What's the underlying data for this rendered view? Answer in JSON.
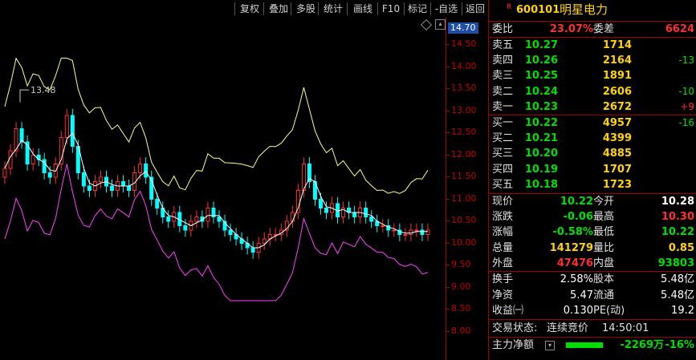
{
  "toolbar": {
    "items": [
      "复权",
      "叠加",
      "多股",
      "统计",
      "画线",
      "F10",
      "标记",
      "-自选",
      "返回"
    ]
  },
  "chart": {
    "price_label": "14.70",
    "y_ticks": [
      "14.50",
      "14.00",
      "13.50",
      "13.00",
      "12.50",
      "12.00",
      "11.50",
      "11.00",
      "10.50",
      "10.00",
      "9.50",
      "9.00",
      "8.50",
      "8.00"
    ],
    "high_marker": "13.48",
    "colors": {
      "up": "#ff3030",
      "down": "#00ffff",
      "upper_band": "#ffff80",
      "lower_band": "#ff40ff",
      "mid": "#ffffff",
      "axis": "#a00000"
    }
  },
  "quote": {
    "badge": "R",
    "code": "600101",
    "name": "明星电力",
    "wei_bi_label": "委比",
    "wei_bi": "23.07%",
    "wei_cha_label": "委差",
    "wei_cha": "6624",
    "asks": [
      {
        "label": "卖五",
        "price": "10.27",
        "vol": "1714",
        "chg": ""
      },
      {
        "label": "卖四",
        "price": "10.26",
        "vol": "2164",
        "chg": "-13"
      },
      {
        "label": "卖三",
        "price": "10.25",
        "vol": "1891",
        "chg": ""
      },
      {
        "label": "卖二",
        "price": "10.24",
        "vol": "2606",
        "chg": "-10"
      },
      {
        "label": "卖一",
        "price": "10.23",
        "vol": "2672",
        "chg": "+9"
      }
    ],
    "bids": [
      {
        "label": "买一",
        "price": "10.22",
        "vol": "4957",
        "chg": "-16"
      },
      {
        "label": "买二",
        "price": "10.21",
        "vol": "4399",
        "chg": ""
      },
      {
        "label": "买三",
        "price": "10.20",
        "vol": "4885",
        "chg": ""
      },
      {
        "label": "买四",
        "price": "10.19",
        "vol": "1707",
        "chg": ""
      },
      {
        "label": "买五",
        "price": "10.18",
        "vol": "1723",
        "chg": ""
      }
    ],
    "stats": [
      {
        "l1": "现价",
        "v1": "10.22",
        "c1": "green",
        "l2": "今开",
        "v2": "10.28",
        "c2": "white"
      },
      {
        "l1": "涨跌",
        "v1": "-0.06",
        "c1": "green",
        "l2": "最高",
        "v2": "10.30",
        "c2": "red"
      },
      {
        "l1": "涨幅",
        "v1": "-0.58%",
        "c1": "green",
        "l2": "最低",
        "v2": "10.22",
        "c2": "green"
      },
      {
        "l1": "总量",
        "v1": "141279",
        "c1": "yellow",
        "l2": "量比",
        "v2": "0.85",
        "c2": "yellow"
      },
      {
        "l1": "外盘",
        "v1": "47476",
        "c1": "red",
        "l2": "内盘",
        "v2": "93803",
        "c2": "green"
      }
    ],
    "fund": [
      {
        "l1": "换手",
        "v1": "2.58%",
        "l2": "股本",
        "v2": "5.48亿"
      },
      {
        "l1": "净资",
        "v1": "5.47",
        "l2": "流通",
        "v2": "5.48亿"
      },
      {
        "l1": "收益㈠",
        "v1": "0.130",
        "l2": "PE(动)",
        "v2": "19.2"
      }
    ],
    "status_label": "交易状态:",
    "status_value": "连续竞价",
    "status_time": "14:50:01",
    "main_flow_label": "主力净额",
    "main_flow_value": "-2269万",
    "main_flow_pct": "-16%"
  }
}
